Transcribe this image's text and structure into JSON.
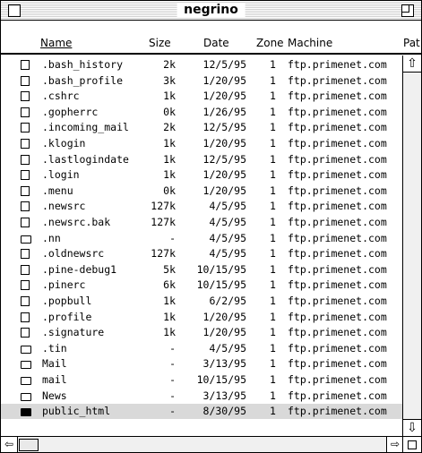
{
  "window": {
    "title": "negrino"
  },
  "columns": {
    "name": "Name",
    "size": "Size",
    "date": "Date",
    "zone": "Zone",
    "machine": "Machine",
    "path": "Pat"
  },
  "files": [
    {
      "name": ".bash_history",
      "size": "2k",
      "date": "12/5/95",
      "zone": "1",
      "machine": "ftp.primenet.com",
      "kind": "file"
    },
    {
      "name": ".bash_profile",
      "size": "3k",
      "date": "1/20/95",
      "zone": "1",
      "machine": "ftp.primenet.com",
      "kind": "file"
    },
    {
      "name": ".cshrc",
      "size": "1k",
      "date": "1/20/95",
      "zone": "1",
      "machine": "ftp.primenet.com",
      "kind": "file"
    },
    {
      "name": ".gopherrc",
      "size": "0k",
      "date": "1/26/95",
      "zone": "1",
      "machine": "ftp.primenet.com",
      "kind": "file"
    },
    {
      "name": ".incoming_mail",
      "size": "2k",
      "date": "12/5/95",
      "zone": "1",
      "machine": "ftp.primenet.com",
      "kind": "file"
    },
    {
      "name": ".klogin",
      "size": "1k",
      "date": "1/20/95",
      "zone": "1",
      "machine": "ftp.primenet.com",
      "kind": "file"
    },
    {
      "name": ".lastlogindate",
      "size": "1k",
      "date": "12/5/95",
      "zone": "1",
      "machine": "ftp.primenet.com",
      "kind": "file"
    },
    {
      "name": ".login",
      "size": "1k",
      "date": "1/20/95",
      "zone": "1",
      "machine": "ftp.primenet.com",
      "kind": "file"
    },
    {
      "name": ".menu",
      "size": "0k",
      "date": "1/20/95",
      "zone": "1",
      "machine": "ftp.primenet.com",
      "kind": "file"
    },
    {
      "name": ".newsrc",
      "size": "127k",
      "date": "4/5/95",
      "zone": "1",
      "machine": "ftp.primenet.com",
      "kind": "file"
    },
    {
      "name": ".newsrc.bak",
      "size": "127k",
      "date": "4/5/95",
      "zone": "1",
      "machine": "ftp.primenet.com",
      "kind": "file"
    },
    {
      "name": ".nn",
      "size": "-",
      "date": "4/5/95",
      "zone": "1",
      "machine": "ftp.primenet.com",
      "kind": "folder"
    },
    {
      "name": ".oldnewsrc",
      "size": "127k",
      "date": "4/5/95",
      "zone": "1",
      "machine": "ftp.primenet.com",
      "kind": "file"
    },
    {
      "name": ".pine-debug1",
      "size": "5k",
      "date": "10/15/95",
      "zone": "1",
      "machine": "ftp.primenet.com",
      "kind": "file"
    },
    {
      "name": ".pinerc",
      "size": "6k",
      "date": "10/15/95",
      "zone": "1",
      "machine": "ftp.primenet.com",
      "kind": "file"
    },
    {
      "name": ".popbull",
      "size": "1k",
      "date": "6/2/95",
      "zone": "1",
      "machine": "ftp.primenet.com",
      "kind": "file"
    },
    {
      "name": ".profile",
      "size": "1k",
      "date": "1/20/95",
      "zone": "1",
      "machine": "ftp.primenet.com",
      "kind": "file"
    },
    {
      "name": ".signature",
      "size": "1k",
      "date": "1/20/95",
      "zone": "1",
      "machine": "ftp.primenet.com",
      "kind": "file"
    },
    {
      "name": ".tin",
      "size": "-",
      "date": "4/5/95",
      "zone": "1",
      "machine": "ftp.primenet.com",
      "kind": "folder"
    },
    {
      "name": "Mail",
      "size": "-",
      "date": "3/13/95",
      "zone": "1",
      "machine": "ftp.primenet.com",
      "kind": "folder"
    },
    {
      "name": "mail",
      "size": "-",
      "date": "10/15/95",
      "zone": "1",
      "machine": "ftp.primenet.com",
      "kind": "folder"
    },
    {
      "name": "News",
      "size": "-",
      "date": "3/13/95",
      "zone": "1",
      "machine": "ftp.primenet.com",
      "kind": "folder"
    },
    {
      "name": "public_html",
      "size": "-",
      "date": "8/30/95",
      "zone": "1",
      "machine": "ftp.primenet.com",
      "kind": "folder-filled",
      "selected": true
    }
  ],
  "scroll": {
    "up_glyph": "⇧",
    "down_glyph": "⇩",
    "left_glyph": "⇦",
    "right_glyph": "⇨"
  }
}
